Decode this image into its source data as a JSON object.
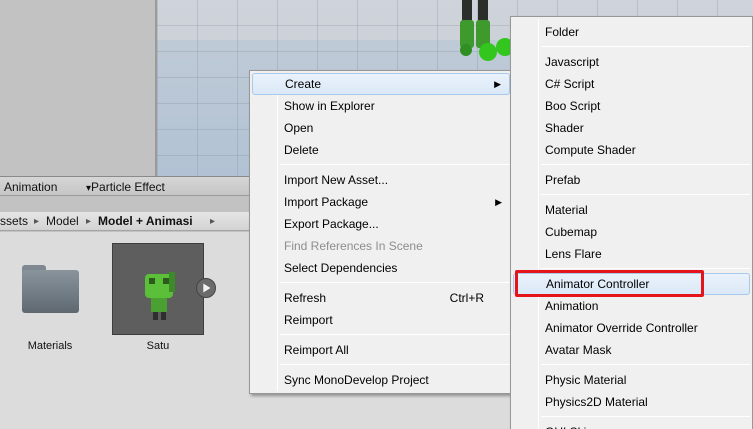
{
  "tabs": [
    {
      "label": "Animation"
    },
    {
      "label": "Particle Effect",
      "prefix": "▾"
    }
  ],
  "breadcrumb": [
    {
      "label": "ssets"
    },
    {
      "label": "Model"
    },
    {
      "label": "Model + Animasi"
    }
  ],
  "assets": [
    {
      "label": "Materials",
      "icon": "folder-icon"
    },
    {
      "label": "Satu",
      "icon": "model-icon"
    }
  ],
  "context_menu": {
    "items": [
      {
        "label": "Create",
        "submenu": true,
        "highlighted": true
      },
      {
        "label": "Show in Explorer"
      },
      {
        "label": "Open"
      },
      {
        "label": "Delete"
      },
      {
        "label": "Import New Asset..."
      },
      {
        "label": "Import Package",
        "submenu": true
      },
      {
        "label": "Export Package..."
      },
      {
        "label": "Find References In Scene",
        "disabled": true
      },
      {
        "label": "Select Dependencies"
      },
      {
        "label": "Refresh",
        "shortcut": "Ctrl+R"
      },
      {
        "label": "Reimport"
      },
      {
        "label": "Reimport All"
      },
      {
        "label": "Sync MonoDevelop Project"
      }
    ]
  },
  "create_submenu": {
    "items": [
      {
        "label": "Folder"
      },
      {
        "label": "Javascript"
      },
      {
        "label": "C# Script"
      },
      {
        "label": "Boo Script"
      },
      {
        "label": "Shader"
      },
      {
        "label": "Compute Shader"
      },
      {
        "label": "Prefab"
      },
      {
        "label": "Material"
      },
      {
        "label": "Cubemap"
      },
      {
        "label": "Lens Flare"
      },
      {
        "label": "Animator Controller",
        "highlighted": true
      },
      {
        "label": "Animation"
      },
      {
        "label": "Animator Override Controller"
      },
      {
        "label": "Avatar Mask"
      },
      {
        "label": "Physic Material"
      },
      {
        "label": "Physics2D Material"
      },
      {
        "label": "GUI Skin"
      }
    ]
  },
  "colors": {
    "highlight_box": "#e4141a",
    "model_green": "#5cbf3a"
  }
}
